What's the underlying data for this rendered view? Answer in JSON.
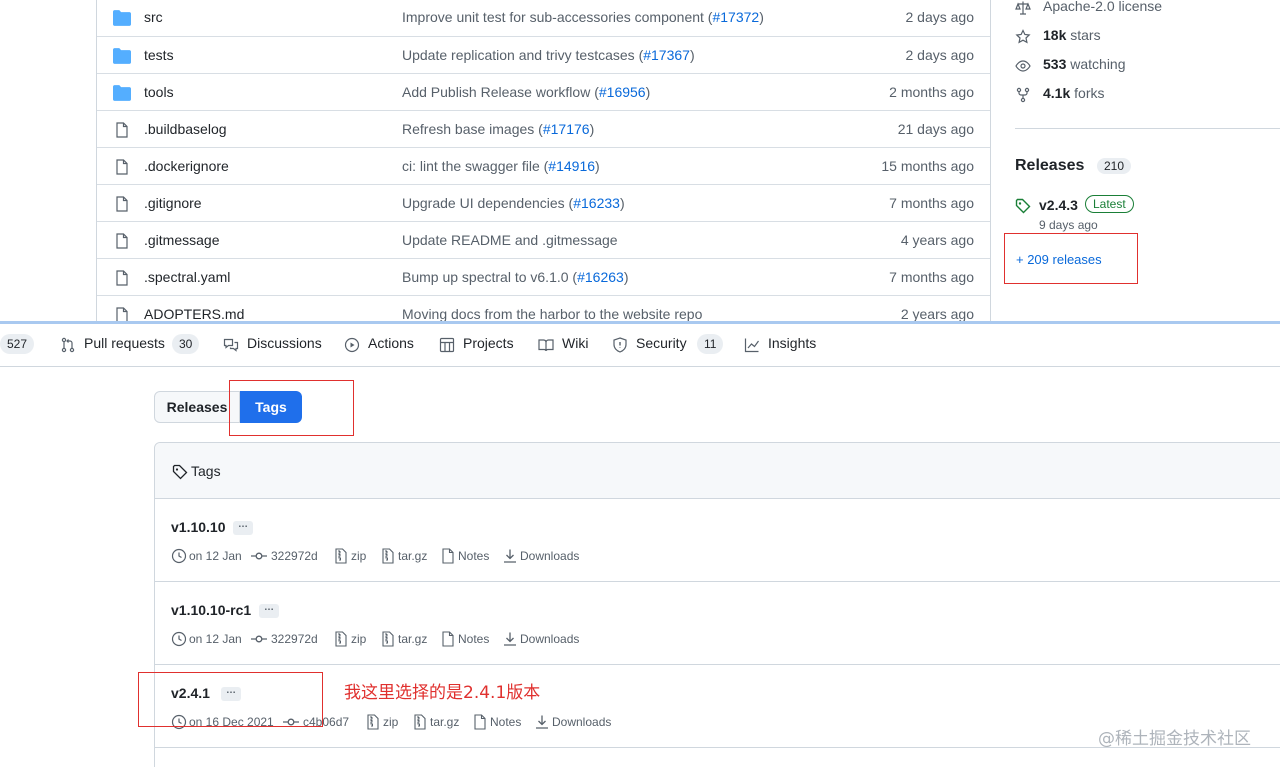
{
  "files": [
    {
      "type": "folder",
      "name": "src",
      "message": "Improve unit test for sub-accessories component (",
      "pr": "#17372",
      "tail": ")",
      "age": "2 days ago"
    },
    {
      "type": "folder",
      "name": "tests",
      "message": "Update replication and trivy testcases (",
      "pr": "#17367",
      "tail": ")",
      "age": "2 days ago"
    },
    {
      "type": "folder",
      "name": "tools",
      "message": "Add Publish Release workflow (",
      "pr": "#16956",
      "tail": ")",
      "age": "2 months ago"
    },
    {
      "type": "file",
      "name": ".buildbaselog",
      "message": "Refresh base images (",
      "pr": "#17176",
      "tail": ")",
      "age": "21 days ago"
    },
    {
      "type": "file",
      "name": ".dockerignore",
      "message": "ci: lint the swagger file (",
      "pr": "#14916",
      "tail": ")",
      "age": "15 months ago"
    },
    {
      "type": "file",
      "name": ".gitignore",
      "message": "Upgrade UI dependencies (",
      "pr": "#16233",
      "tail": ")",
      "age": "7 months ago"
    },
    {
      "type": "file",
      "name": ".gitmessage",
      "message": "Update README and .gitmessage",
      "pr": "",
      "tail": "",
      "age": "4 years ago"
    },
    {
      "type": "file",
      "name": ".spectral.yaml",
      "message": "Bump up spectral to v6.1.0 (",
      "pr": "#16263",
      "tail": ")",
      "age": "7 months ago"
    },
    {
      "type": "file",
      "name": "ADOPTERS.md",
      "message": "Moving docs from the harbor to the website repo",
      "pr": "",
      "tail": "",
      "age": "2 years ago"
    }
  ],
  "sidebar": {
    "license": "Apache-2.0 license",
    "stars_count": "18k",
    "stars_label": " stars",
    "watching_count": "533",
    "watching_label": " watching",
    "forks_count": "4.1k",
    "forks_label": " forks",
    "releases_heading": "Releases",
    "releases_count": "210",
    "latest_version": "v2.4.3",
    "latest_badge": "Latest",
    "latest_date": "9 days ago",
    "more_releases": "+ 209 releases"
  },
  "nav": {
    "issues_count": "527",
    "pull_requests": "Pull requests",
    "pull_requests_count": "30",
    "discussions": "Discussions",
    "actions": "Actions",
    "projects": "Projects",
    "wiki": "Wiki",
    "security": "Security",
    "security_count": "11",
    "insights": "Insights"
  },
  "toggle": {
    "releases": "Releases",
    "tags": "Tags"
  },
  "tags_header": "Tags",
  "tags": [
    {
      "name": "v1.10.10",
      "date": "on 12 Jan",
      "commit": "322972d",
      "zip": "zip",
      "targz": "tar.gz",
      "notes": "Notes",
      "downloads": "Downloads"
    },
    {
      "name": "v1.10.10-rc1",
      "date": "on 12 Jan",
      "commit": "322972d",
      "zip": "zip",
      "targz": "tar.gz",
      "notes": "Notes",
      "downloads": "Downloads"
    },
    {
      "name": "v2.4.1",
      "date": "on 16 Dec 2021",
      "commit": "c4b06d7",
      "zip": "zip",
      "targz": "tar.gz",
      "notes": "Notes",
      "downloads": "Downloads"
    }
  ],
  "ellipsis": "…",
  "annotation": "我这里选择的是2.4.1版本",
  "watermark": "@稀土掘金技术社区",
  "colors": {
    "link": "#0969da",
    "accent_button": "#1f6feb",
    "annotation_red": "#e0302e",
    "latest_green": "#1a7f37",
    "folder_blue": "#54aeff"
  }
}
